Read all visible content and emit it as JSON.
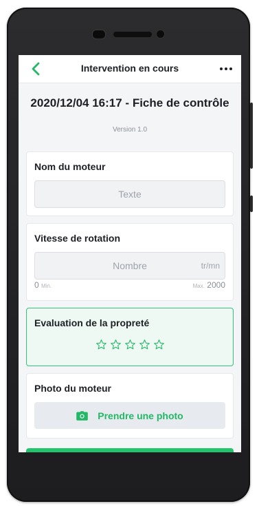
{
  "header": {
    "title": "Intervention en cours",
    "back_icon": "chevron-left-icon",
    "menu_icon": "more-horizontal-icon"
  },
  "form": {
    "title": "2020/12/04 16:17 - Fiche de contrôle",
    "version": "Version 1.0"
  },
  "fields": {
    "motor_name": {
      "label": "Nom du moteur",
      "placeholder": "Texte",
      "value": ""
    },
    "rotation_speed": {
      "label": "Vitesse de rotation",
      "placeholder": "Nombre",
      "unit": "tr/mn",
      "min_value": "0",
      "min_label": "Min.",
      "max_label": "Max.",
      "max_value": "2000"
    },
    "cleanliness": {
      "label": "Evaluation de la propreté",
      "rating": 0,
      "max_rating": 5
    },
    "motor_photo": {
      "label": "Photo du moteur",
      "button_label": "Prendre une photo",
      "button_icon": "camera-icon"
    }
  },
  "colors": {
    "accent": "#22b866",
    "accent_border": "#2fc47a",
    "active_card_bg": "#edf9f2"
  }
}
